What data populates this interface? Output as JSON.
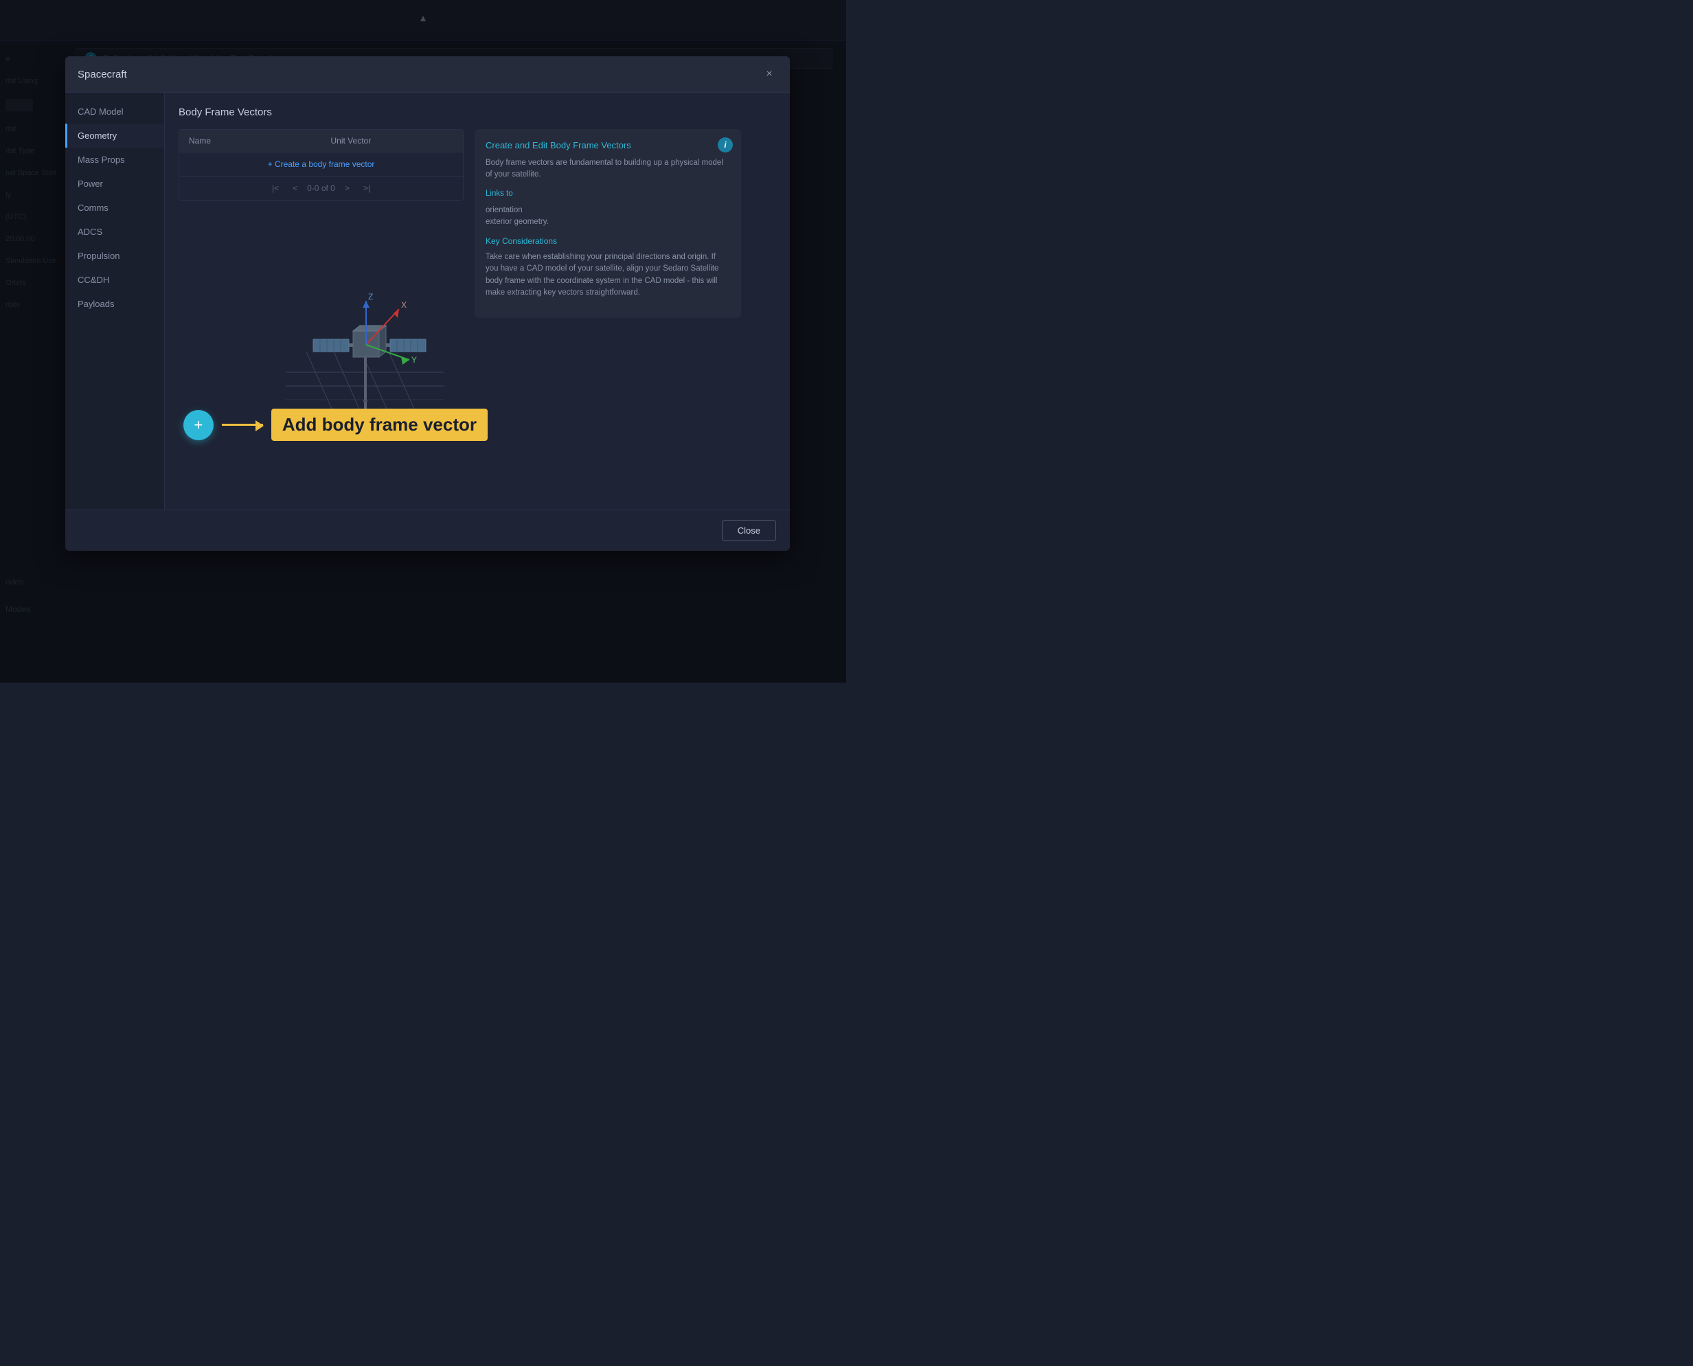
{
  "app": {
    "title": "Spacecraft"
  },
  "background": {
    "left_items": [
      {
        "label": "e"
      },
      {
        "label": "rbit Using:"
      },
      {
        "label": "rbit"
      },
      {
        "label": "rbit Type"
      },
      {
        "label": "nal Space Stati"
      },
      {
        "label": "ly"
      },
      {
        "label": "(UTC)"
      },
      {
        "label": "20:00:00"
      },
      {
        "label": "Simulation Usin"
      },
      {
        "label": "Orbits"
      },
      {
        "label": "rbits"
      }
    ],
    "modes_label": "odes",
    "modes_label2": "Modes",
    "info_banner": "Define the Initial Orbit and Simulation Time Period"
  },
  "modal": {
    "title": "Spacecraft",
    "close_label": "×",
    "sidebar": {
      "items": [
        {
          "label": "CAD Model",
          "active": false
        },
        {
          "label": "Geometry",
          "active": true
        },
        {
          "label": "Mass Props",
          "active": false
        },
        {
          "label": "Power",
          "active": false
        },
        {
          "label": "Comms",
          "active": false
        },
        {
          "label": "ADCS",
          "active": false
        },
        {
          "label": "Propulsion",
          "active": false
        },
        {
          "label": "CC&DH",
          "active": false
        },
        {
          "label": "Payloads",
          "active": false
        }
      ]
    },
    "body_frame_vectors": {
      "section_title": "Body Frame Vectors",
      "table": {
        "headers": [
          "Name",
          "Unit Vector"
        ],
        "create_row_label": "+ Create a body frame vector",
        "pagination": {
          "first_label": "|<",
          "prev_label": "<",
          "page_info": "0-0 of 0",
          "next_label": ">",
          "last_label": ">|"
        }
      }
    },
    "info_panel": {
      "title": "Create and Edit Body Frame Vectors",
      "description": "Body frame vectors are fundamental to building up a physical model of your satellite.",
      "links_text": "Links to",
      "orientation_text": "orientation\nexterior geometry.",
      "key_considerations_title": "Key Considerations",
      "key_considerations_text": "Take care when establishing your principal directions and origin. If you have a CAD model of your satellite, align your Sedaro Satellite body frame with the coordinate system in the CAD model - this will make extracting key vectors straightforward."
    },
    "add_annotation": {
      "button_label": "+",
      "arrow_label": "→",
      "text": "Add body frame vector"
    },
    "footer": {
      "close_button_label": "Close"
    }
  },
  "visualization": {
    "x_label": "X",
    "y_label": "Y",
    "z_label": "Z"
  }
}
